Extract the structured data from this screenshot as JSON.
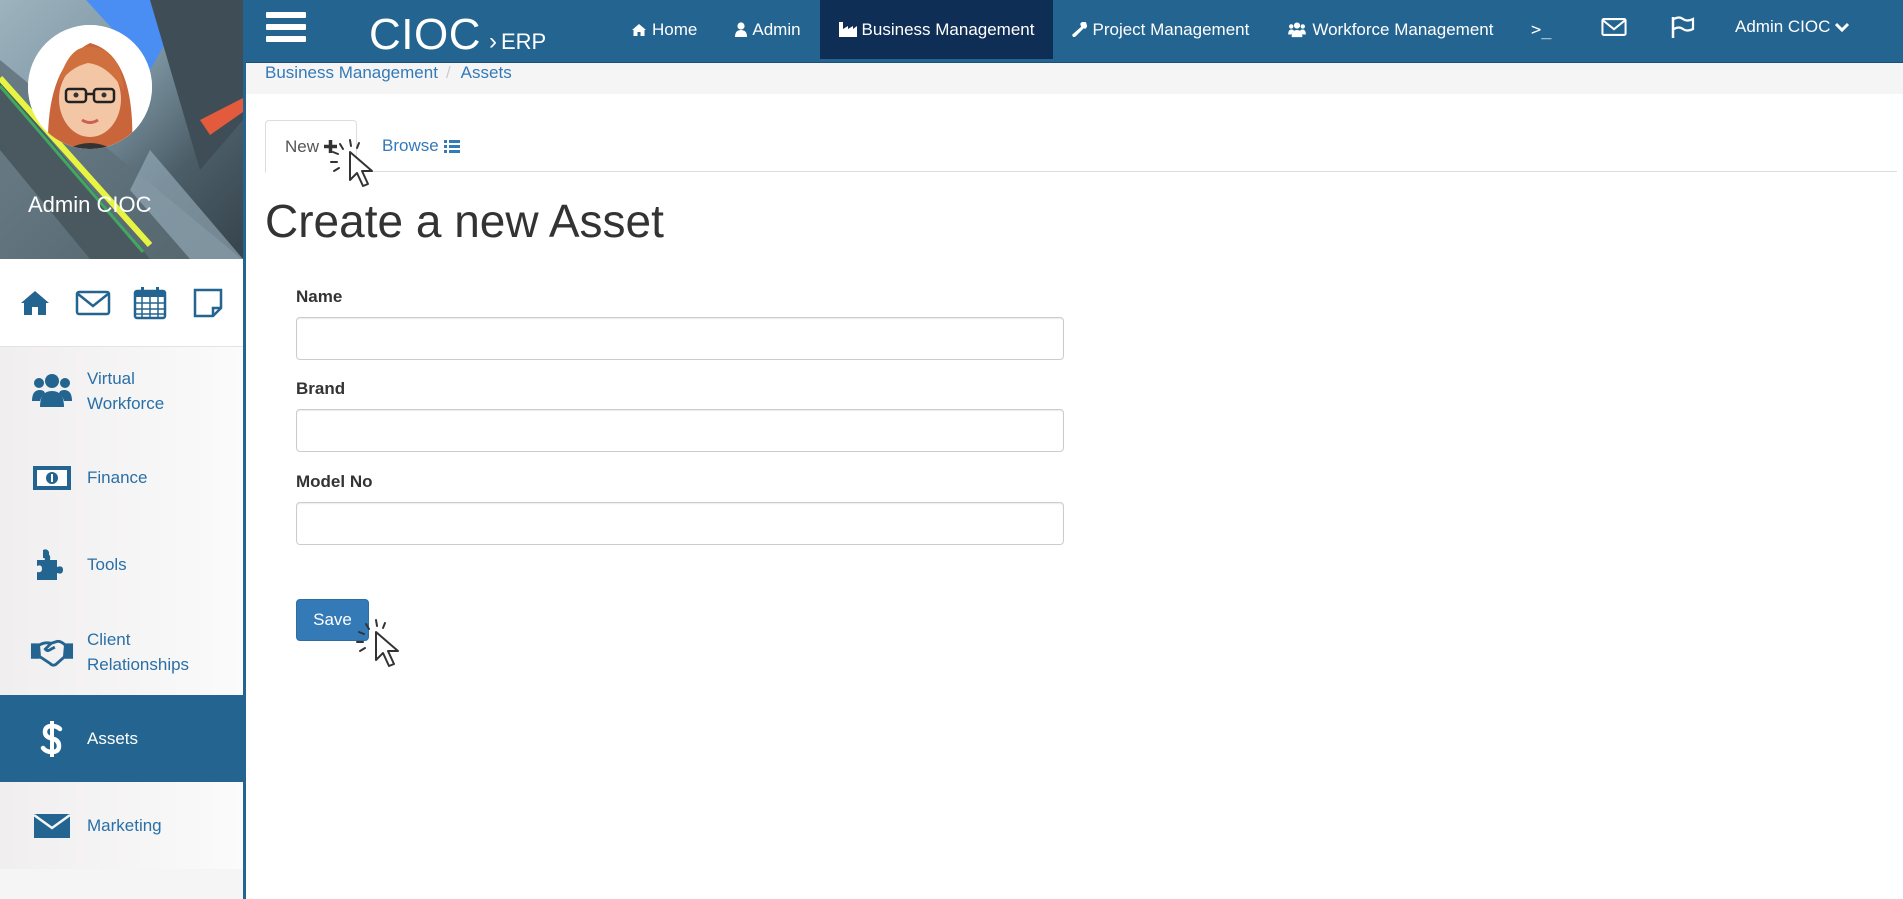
{
  "sidebar": {
    "user_name": "Admin CIOC",
    "quick_icons": [
      "home-icon",
      "envelope-icon",
      "calendar-icon",
      "sticky-note-icon"
    ],
    "items": [
      {
        "label_line1": "Virtual",
        "label_line2": "Workforce",
        "icon": "users-icon"
      },
      {
        "label_line1": "Finance",
        "label_line2": "",
        "icon": "money-icon"
      },
      {
        "label_line1": "Tools",
        "label_line2": "",
        "icon": "puzzle-icon"
      },
      {
        "label_line1": "Client",
        "label_line2": "Relationships",
        "icon": "handshake-icon"
      },
      {
        "label_line1": "Assets",
        "label_line2": "",
        "icon": "dollar-icon",
        "active": true
      },
      {
        "label_line1": "Marketing",
        "label_line2": "",
        "icon": "envelope-icon"
      }
    ]
  },
  "topbar": {
    "brand": "CIOC",
    "brand_chevron": "›",
    "brand_sub": "ERP",
    "nav": [
      {
        "label": "Home",
        "icon": "home-icon"
      },
      {
        "label": "Admin",
        "icon": "user-icon"
      },
      {
        "label": "Business Management",
        "icon": "industry-icon",
        "active": true
      },
      {
        "label": "Project Management",
        "icon": "wrench-icon"
      },
      {
        "label": "Workforce Management",
        "icon": "users-icon"
      }
    ],
    "terminal": ">_",
    "user_menu": "Admin CIOC"
  },
  "breadcrumb": {
    "items": [
      "Business Management",
      "Assets"
    ]
  },
  "tabs": {
    "new_label": "New",
    "browse_label": "Browse"
  },
  "page": {
    "title": "Create a new Asset"
  },
  "form": {
    "name_label": "Name",
    "name_value": "",
    "brand_label": "Brand",
    "brand_value": "",
    "model_label": "Model No",
    "model_value": "",
    "save_label": "Save"
  },
  "colors": {
    "primary": "#236490",
    "active_nav": "#0f2e55",
    "link": "#337ab7",
    "button": "#337ab7"
  }
}
